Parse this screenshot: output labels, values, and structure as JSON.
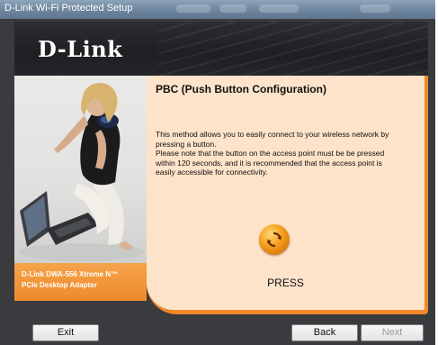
{
  "window": {
    "title": "D-Link Wi-Fi Protected Setup"
  },
  "header": {
    "logo_text": "D-Link"
  },
  "sidebar": {
    "product_name": "D-Link DWA-556 Xtreme N™\nPCIe Desktop Adapter"
  },
  "content": {
    "heading": "PBC (Push Button Configuration)",
    "paragraph_lines": [
      "This method allows you to easily connect to your wireless network by",
      "pressing a button.",
      "Please note that the button on the access point must be be pressed",
      "within 120 seconds, and it is recommended that the access point is",
      "easily accessible for connectivity."
    ],
    "press_label": "PRESS",
    "press_icon": "wps-push-button-icon"
  },
  "buttons": {
    "exit": "Exit",
    "back": "Back",
    "next": "Next",
    "next_enabled": false
  },
  "colors": {
    "accent_orange": "#F08A2B",
    "content_background": "#FDE3C9",
    "header_dark": "#232427"
  }
}
